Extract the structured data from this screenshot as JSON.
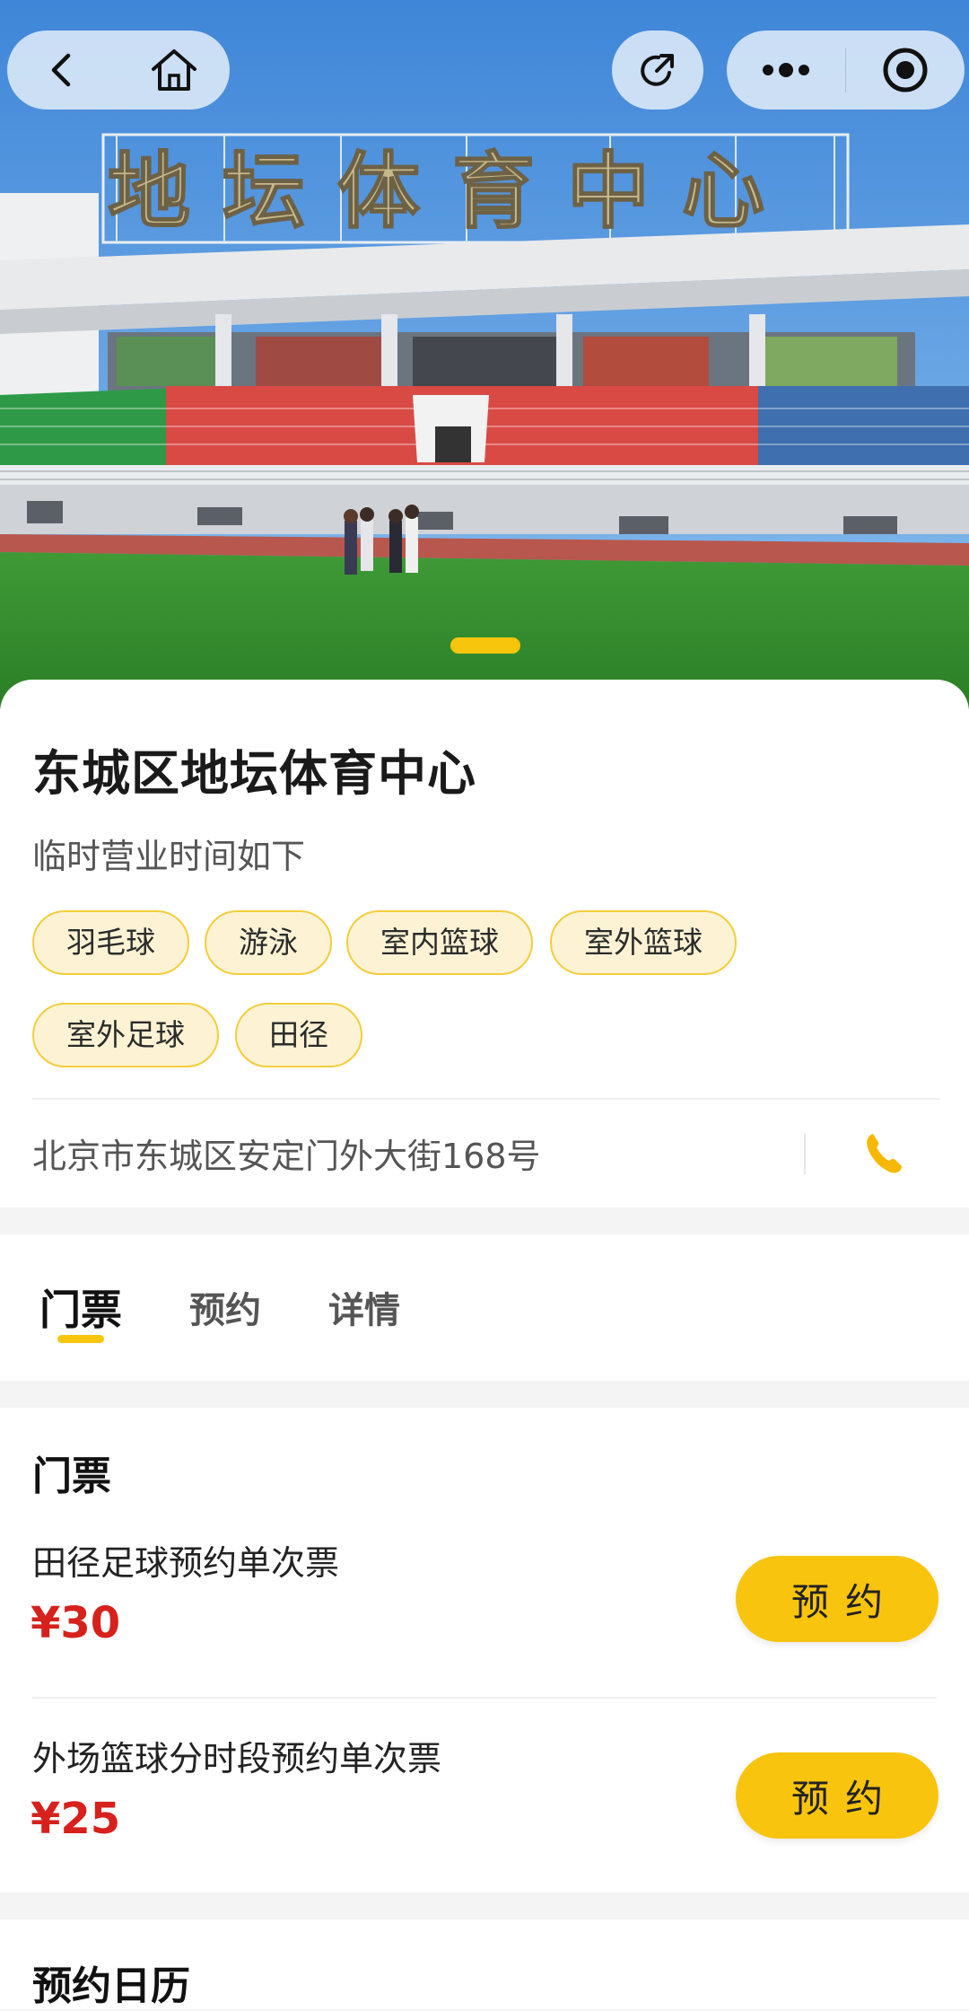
{
  "hero": {
    "image_desc": "stadium-photo",
    "sign_text": "地坛体育中心",
    "carousel_active_index": 0
  },
  "venue": {
    "name": "东城区地坛体育中心",
    "hours_note": "临时营业时间如下",
    "tags": [
      "羽毛球",
      "游泳",
      "室内篮球",
      "室外篮球",
      "室外足球",
      "田径"
    ],
    "address": "北京市东城区安定门外大街168号"
  },
  "tabs": [
    {
      "label": "门票",
      "active": true
    },
    {
      "label": "预约",
      "active": false
    },
    {
      "label": "详情",
      "active": false
    }
  ],
  "tickets": {
    "title": "门票",
    "items": [
      {
        "name": "田径足球预约单次票",
        "price": "¥30",
        "button": "预约"
      },
      {
        "name": "外场篮球分时段预约单次票",
        "price": "¥25",
        "button": "预约"
      }
    ]
  },
  "calendar": {
    "title": "预约日历"
  },
  "colors": {
    "accent": "#f9c40e",
    "price": "#d6211c",
    "tag_bg": "#fdf3d4",
    "tag_border": "#f3cd3c"
  }
}
